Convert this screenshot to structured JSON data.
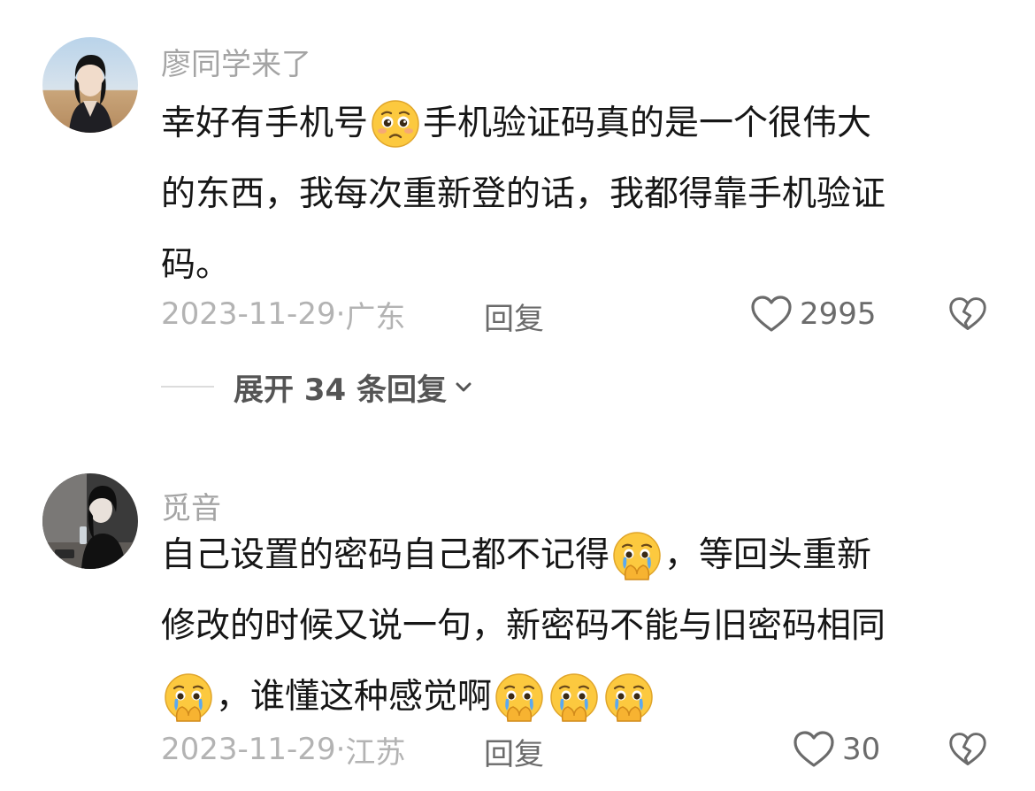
{
  "comments": [
    {
      "username": "廖同学来了",
      "lines": [
        [
          "幸好有手机号",
          {
            "emoji": "pleading-face-icon"
          },
          "手机验证码真的是一个很伟大"
        ],
        [
          "的东西，我每次重新登的话，我都得靠手机验证"
        ],
        [
          "码。"
        ]
      ],
      "date": "2023-11-29",
      "location": "广东",
      "reply_label": "回复",
      "likes": "2995",
      "expand_label": "展开 34 条回复"
    },
    {
      "username": "觅音",
      "lines": [
        [
          "自己设置的密码自己都不记得",
          {
            "emoji": "crying-hands-face-icon"
          },
          "，等回头重新"
        ],
        [
          "修改的时候又说一句，新密码不能与旧密码相同"
        ],
        [
          {
            "emoji": "crying-hands-face-icon"
          },
          "，谁懂这种感觉啊",
          {
            "emoji": "crying-hands-face-icon"
          },
          {
            "emoji": "crying-hands-face-icon"
          },
          {
            "emoji": "crying-hands-face-icon"
          }
        ]
      ],
      "date": "2023-11-29",
      "location": "江苏",
      "reply_label": "回复",
      "likes": "30"
    }
  ],
  "meta_separator": "·",
  "icons": {
    "like": "heart-outline-icon",
    "dislike": "broken-heart-icon",
    "expand": "chevron-down-icon"
  },
  "colors": {
    "username": "#a4a4a4",
    "meta": "#b3b3b3",
    "action": "#6b6b6b",
    "emoji_face": "#fcc93f"
  }
}
